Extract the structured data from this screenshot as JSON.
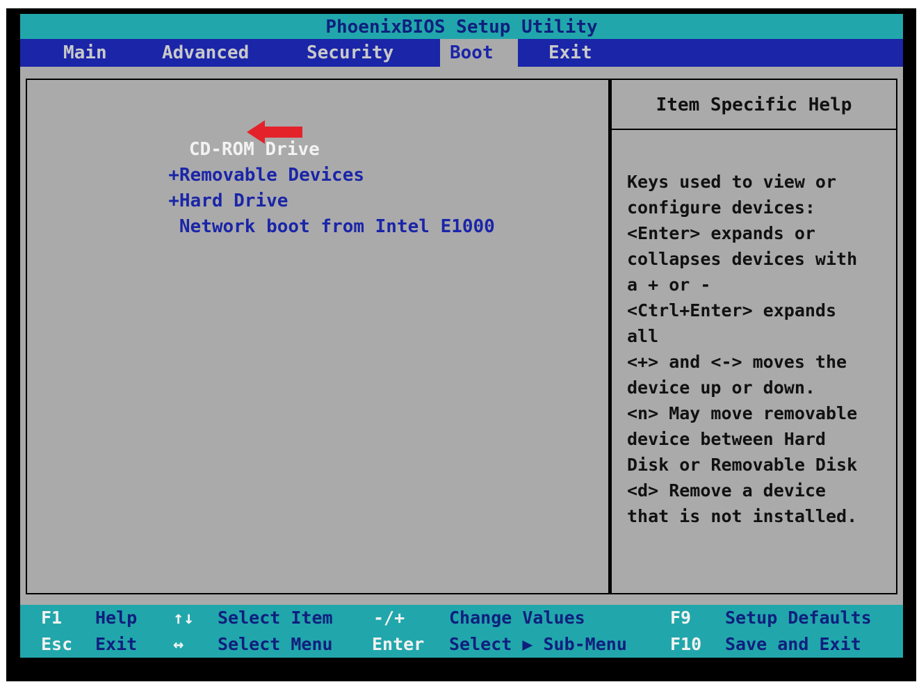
{
  "title": "PhoenixBIOS Setup Utility",
  "menu": [
    "Main",
    "Advanced",
    "Security",
    "Boot",
    "Exit"
  ],
  "active_menu": "Boot",
  "boot_items": [
    {
      "prefix": " ",
      "label": "CD-ROM Drive"
    },
    {
      "prefix": "+",
      "label": "Removable Devices"
    },
    {
      "prefix": "+",
      "label": "Hard Drive"
    },
    {
      "prefix": " ",
      "label": "Network boot from Intel E1000"
    }
  ],
  "help": {
    "title": "Item Specific Help",
    "lines": [
      "Keys used to view or",
      "configure devices:",
      "<Enter> expands or",
      "collapses devices with",
      "a + or -",
      "<Ctrl+Enter> expands",
      "all",
      "<+> and <-> moves the",
      "device up or down.",
      "<n> May move removable",
      "device between Hard",
      "Disk or Removable Disk",
      "<d> Remove a device",
      "that is not installed."
    ]
  },
  "footer": {
    "row1": [
      {
        "key": "F1",
        "desc": "Help"
      },
      {
        "key": "↑↓",
        "desc": "Select Item"
      },
      {
        "key": "-/+",
        "desc": "Change Values"
      },
      {
        "key": "F9",
        "desc": "Setup Defaults"
      }
    ],
    "row2": [
      {
        "key": "Esc",
        "desc": "Exit"
      },
      {
        "key": "↔",
        "desc": "Select Menu"
      },
      {
        "key": "Enter",
        "desc": "Select ▶ Sub-Menu"
      },
      {
        "key": "F10",
        "desc": "Save and Exit"
      }
    ]
  },
  "colors": {
    "teal": "#21a7ab",
    "menu_blue": "#1a25a8",
    "panel_gray": "#aaaaaa",
    "arrow_red": "#e4222a"
  },
  "icons": {
    "annotation": "red-arrow-icon"
  }
}
